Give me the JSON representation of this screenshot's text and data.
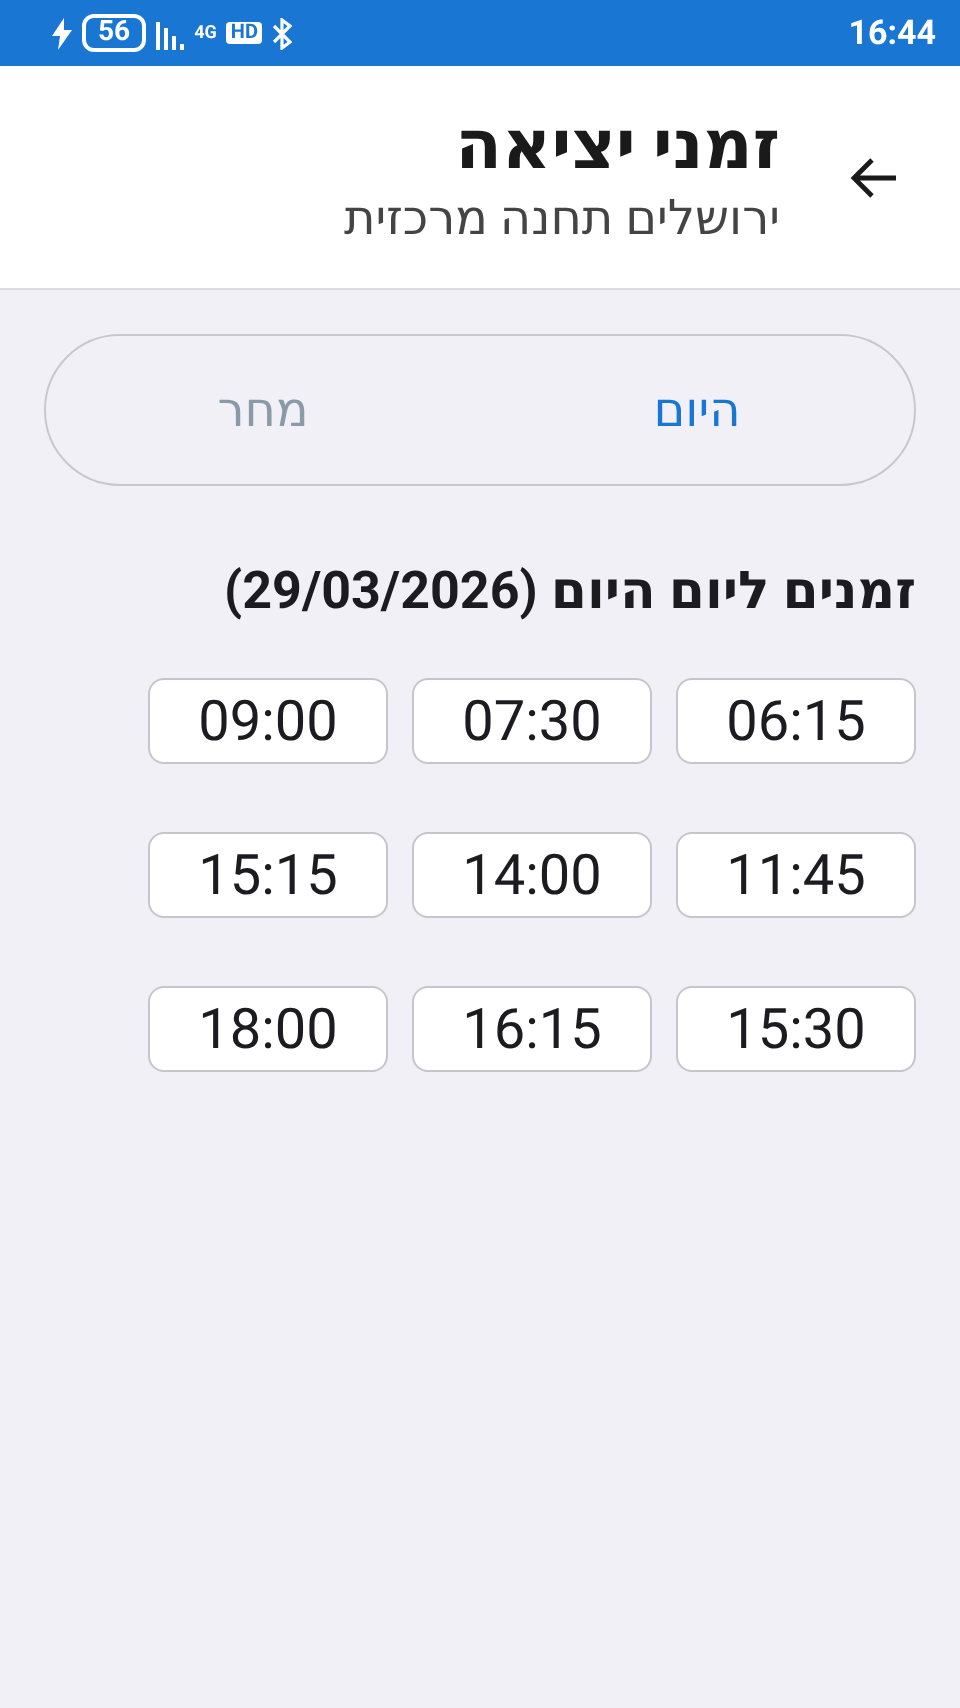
{
  "status_bar": {
    "battery": "56",
    "network": "4G",
    "hd": "HD",
    "time": "16:44"
  },
  "header": {
    "title": "זמני יציאה",
    "subtitle": "ירושלים תחנה מרכזית"
  },
  "tabs": [
    {
      "label": "היום",
      "selected": true
    },
    {
      "label": "מחר",
      "selected": false
    }
  ],
  "section_title": "זמנים ליום היום (29/03/2026)",
  "times": [
    "06:15",
    "07:30",
    "09:00",
    "11:45",
    "14:00",
    "15:15",
    "15:30",
    "16:15",
    "18:00"
  ]
}
